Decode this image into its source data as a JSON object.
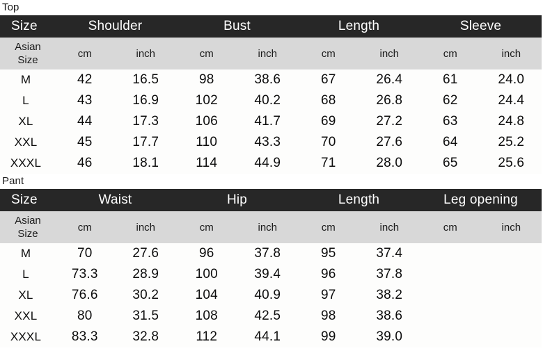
{
  "tables": [
    {
      "label": "Top",
      "size_header": "Size",
      "size_sub": "Asian\nSize",
      "size_sub_line1": "Asian",
      "size_sub_line2": "Size",
      "groups": [
        {
          "name": "Shoulder",
          "units": [
            "cm",
            "inch"
          ]
        },
        {
          "name": "Bust",
          "units": [
            "cm",
            "inch"
          ]
        },
        {
          "name": "Length",
          "units": [
            "cm",
            "inch"
          ]
        },
        {
          "name": "Sleeve",
          "units": [
            "cm",
            "inch"
          ]
        }
      ],
      "rows": [
        {
          "size": "M",
          "cells": [
            "42",
            "16.5",
            "98",
            "38.6",
            "67",
            "26.4",
            "61",
            "24.0"
          ]
        },
        {
          "size": "L",
          "cells": [
            "43",
            "16.9",
            "102",
            "40.2",
            "68",
            "26.8",
            "62",
            "24.4"
          ]
        },
        {
          "size": "XL",
          "cells": [
            "44",
            "17.3",
            "106",
            "41.7",
            "69",
            "27.2",
            "63",
            "24.8"
          ]
        },
        {
          "size": "XXL",
          "cells": [
            "45",
            "17.7",
            "110",
            "43.3",
            "70",
            "27.6",
            "64",
            "25.2"
          ]
        },
        {
          "size": "XXXL",
          "cells": [
            "46",
            "18.1",
            "114",
            "44.9",
            "71",
            "28.0",
            "65",
            "25.6"
          ]
        }
      ]
    },
    {
      "label": "Pant",
      "size_header": "Size",
      "size_sub_line1": "Asian",
      "size_sub_line2": "Size",
      "groups": [
        {
          "name": "Waist",
          "units": [
            "cm",
            "inch"
          ]
        },
        {
          "name": "Hip",
          "units": [
            "cm",
            "inch"
          ]
        },
        {
          "name": "Length",
          "units": [
            "cm",
            "inch"
          ]
        },
        {
          "name": "Leg opening",
          "units": [
            "cm",
            "inch"
          ]
        }
      ],
      "rows": [
        {
          "size": "M",
          "cells": [
            "70",
            "27.6",
            "96",
            "37.8",
            "95",
            "37.4",
            "",
            ""
          ]
        },
        {
          "size": "L",
          "cells": [
            "73.3",
            "28.9",
            "100",
            "39.4",
            "96",
            "37.8",
            "",
            ""
          ]
        },
        {
          "size": "XL",
          "cells": [
            "76.6",
            "30.2",
            "104",
            "40.9",
            "97",
            "38.2",
            "",
            ""
          ]
        },
        {
          "size": "XXL",
          "cells": [
            "80",
            "31.5",
            "108",
            "42.5",
            "98",
            "38.6",
            "",
            ""
          ]
        },
        {
          "size": "XXXL",
          "cells": [
            "83.3",
            "32.8",
            "112",
            "44.1",
            "99",
            "39.0",
            "",
            ""
          ]
        }
      ]
    }
  ],
  "colors": {
    "header_bg": "#272727",
    "header_text": "#ffffff",
    "subheader_bg": "#d8d8d8",
    "body_bg": "#fdfdfc",
    "text": "#0d0d0d"
  }
}
